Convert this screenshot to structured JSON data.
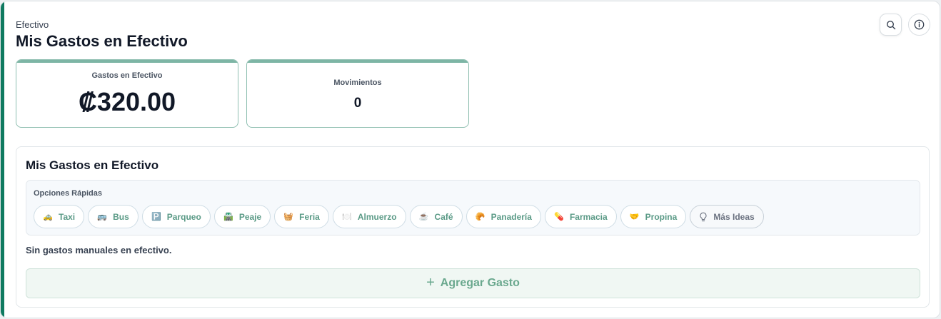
{
  "header": {
    "eyebrow": "Efectivo",
    "title": "Mis Gastos en Efectivo"
  },
  "icons": {
    "search": "search-icon",
    "info": "info-icon"
  },
  "stats": [
    {
      "label": "Gastos en Efectivo",
      "value": "₡320.00"
    },
    {
      "label": "Movimientos",
      "value": "0"
    }
  ],
  "section": {
    "title": "Mis Gastos en Efectivo",
    "quick_label": "Opciones Rápidas",
    "chips": [
      {
        "emoji": "🚕",
        "label": "Taxi"
      },
      {
        "emoji": "🚌",
        "label": "Bus"
      },
      {
        "emoji": "🅿️",
        "label": "Parqueo"
      },
      {
        "emoji": "🛣️",
        "label": "Peaje"
      },
      {
        "emoji": "🧺",
        "label": "Feria"
      },
      {
        "emoji": "🍽️",
        "label": "Almuerzo"
      },
      {
        "emoji": "☕",
        "label": "Café"
      },
      {
        "emoji": "🥐",
        "label": "Panadería"
      },
      {
        "emoji": "💊",
        "label": "Farmacia"
      },
      {
        "emoji": "🤝",
        "label": "Propina"
      }
    ],
    "more_label": "Más Ideas",
    "empty_text": "Sin gastos manuales en efectivo.",
    "add_label": "Agregar Gasto"
  },
  "colors": {
    "accent": "#0f7a60",
    "chip_text": "#5a9a86",
    "add_button_bg": "#f0f7f3"
  }
}
